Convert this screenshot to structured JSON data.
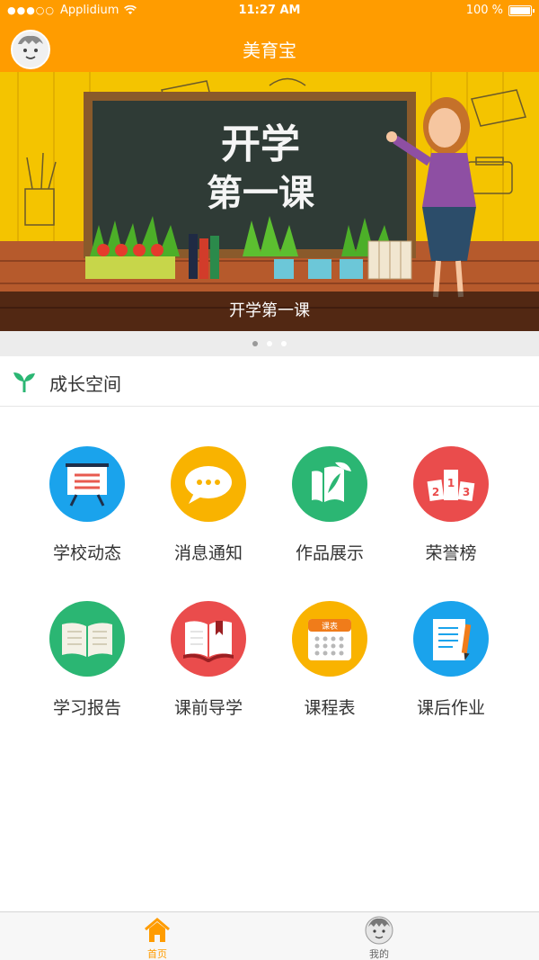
{
  "status_bar": {
    "carrier": "Applidium",
    "time": "11:27 AM",
    "battery": "100 %"
  },
  "nav": {
    "title": "美育宝"
  },
  "banner": {
    "board_line1": "开学",
    "board_line2": "第一课",
    "caption": "开学第一课",
    "slides": 3,
    "active_slide": 1
  },
  "section": {
    "title": "成长空间"
  },
  "tiles": [
    {
      "label": "学校动态",
      "icon": "bulletin-board-icon",
      "color": "#1aa3ec"
    },
    {
      "label": "消息通知",
      "icon": "chat-bubble-icon",
      "color": "#f9b300"
    },
    {
      "label": "作品展示",
      "icon": "artwork-leaf-icon",
      "color": "#2bb673"
    },
    {
      "label": "荣誉榜",
      "icon": "podium-icon",
      "color": "#ea4c4c"
    },
    {
      "label": "学习报告",
      "icon": "open-book-icon",
      "color": "#2bb673"
    },
    {
      "label": "课前导学",
      "icon": "bookmark-book-icon",
      "color": "#ea4c4c"
    },
    {
      "label": "课程表",
      "icon": "calendar-icon",
      "color": "#f9b300",
      "badge": "课表"
    },
    {
      "label": "课后作业",
      "icon": "homework-document-icon",
      "color": "#1aa3ec"
    }
  ],
  "tabbar": {
    "home_label": "首页",
    "mine_label": "我的",
    "active_color": "#ff9c00"
  }
}
